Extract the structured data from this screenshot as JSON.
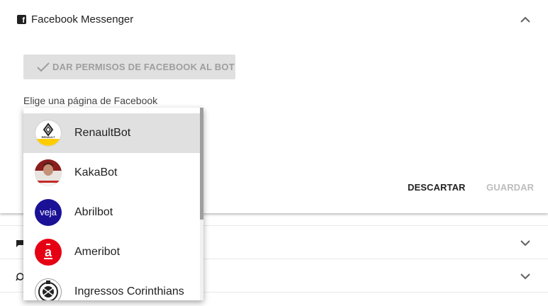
{
  "panel": {
    "title": "Facebook Messenger",
    "permissions_button": "DAR PERMISOS DE FACEBOOK AL BOT",
    "page_select_label": "Elige una página de Facebook",
    "discard_label": "DESCARTAR",
    "save_label": "GUARDAR"
  },
  "dropdown": {
    "selected": "RenaultBot",
    "options": [
      {
        "label": "RenaultBot",
        "avatar": "renault-logo",
        "avatar_text": "RENAULT"
      },
      {
        "label": "KakaBot",
        "avatar": "kaka-photo"
      },
      {
        "label": "Abrilbot",
        "avatar": "veja-logo",
        "avatar_text": "veja"
      },
      {
        "label": "Ameribot",
        "avatar": "americanas-logo",
        "avatar_text": "a"
      },
      {
        "label": "Ingressos Corinthians",
        "avatar": "corinthians-crest"
      }
    ]
  },
  "collapsed_rows": [
    {
      "icon": "chat-icon"
    },
    {
      "icon": "whatsapp-icon"
    }
  ],
  "colors": {
    "selected_bg": "#e0e0e0",
    "disabled_button_bg": "#e0e0e0",
    "veja_blue": "#1a1196",
    "americanas_red": "#e60014",
    "renault_yellow": "#ffcc00"
  }
}
